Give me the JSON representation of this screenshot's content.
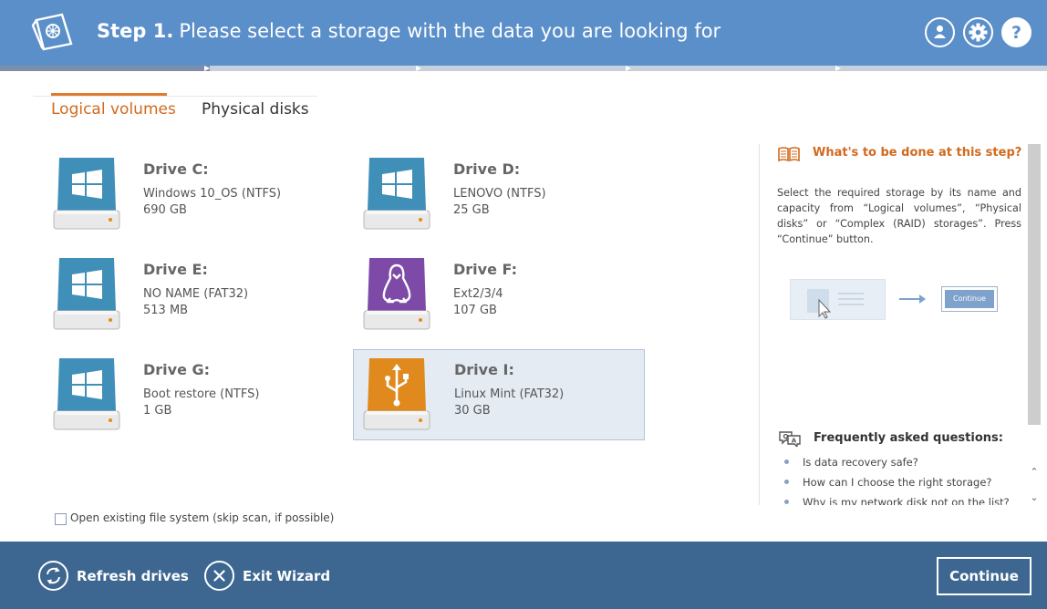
{
  "header": {
    "step_label": "Step 1.",
    "title": "Please select a storage with the data you are looking for"
  },
  "progress": {
    "completed_fraction": 0.2
  },
  "tabs": [
    {
      "label": "Logical volumes",
      "active": true
    },
    {
      "label": "Physical disks",
      "active": false
    }
  ],
  "drives": [
    {
      "name": "Drive C:",
      "fs": "Windows 10_OS (NTFS)",
      "size": "690 GB",
      "icon": "windows-drive-icon",
      "color": "#3f8fb8"
    },
    {
      "name": "Drive D:",
      "fs": "LENOVO (NTFS)",
      "size": "25 GB",
      "icon": "windows-drive-icon",
      "color": "#3f8fb8"
    },
    {
      "name": "Drive E:",
      "fs": "NO NAME (FAT32)",
      "size": "513 MB",
      "icon": "windows-drive-icon",
      "color": "#3f8fb8"
    },
    {
      "name": "Drive F:",
      "fs": "Ext2/3/4",
      "size": "107 GB",
      "icon": "linux-drive-icon",
      "color": "#7e4aa8"
    },
    {
      "name": "Drive G:",
      "fs": "Boot restore (NTFS)",
      "size": "1 GB",
      "icon": "windows-drive-icon",
      "color": "#3f8fb8"
    },
    {
      "name": "Drive I:",
      "fs": "Linux Mint (FAT32)",
      "size": "30 GB",
      "icon": "usb-drive-icon",
      "color": "#e08a1e",
      "selected": true
    }
  ],
  "options": {
    "open_fs_label": "Open existing file system (skip scan, if possible)",
    "open_fs_checked": false
  },
  "help": {
    "title": "What's to be done at this step?",
    "text": "Select the required storage by its name and capacity from “Logical volumes”, “Physical disks” or “Complex (RAID) storages”. Press “Continue” button.",
    "illustration_button": "Continue",
    "faq_title": "Frequently asked questions:",
    "faq": [
      "Is data recovery safe?",
      "How can I choose the right storage?",
      "Why is my network disk not on the list?"
    ]
  },
  "footer": {
    "refresh_label": "Refresh drives",
    "exit_label": "Exit Wizard",
    "continue_label": "Continue"
  },
  "colors": {
    "header": "#5b8fc9",
    "footer": "#3d6790",
    "accent": "#d16a1e"
  }
}
